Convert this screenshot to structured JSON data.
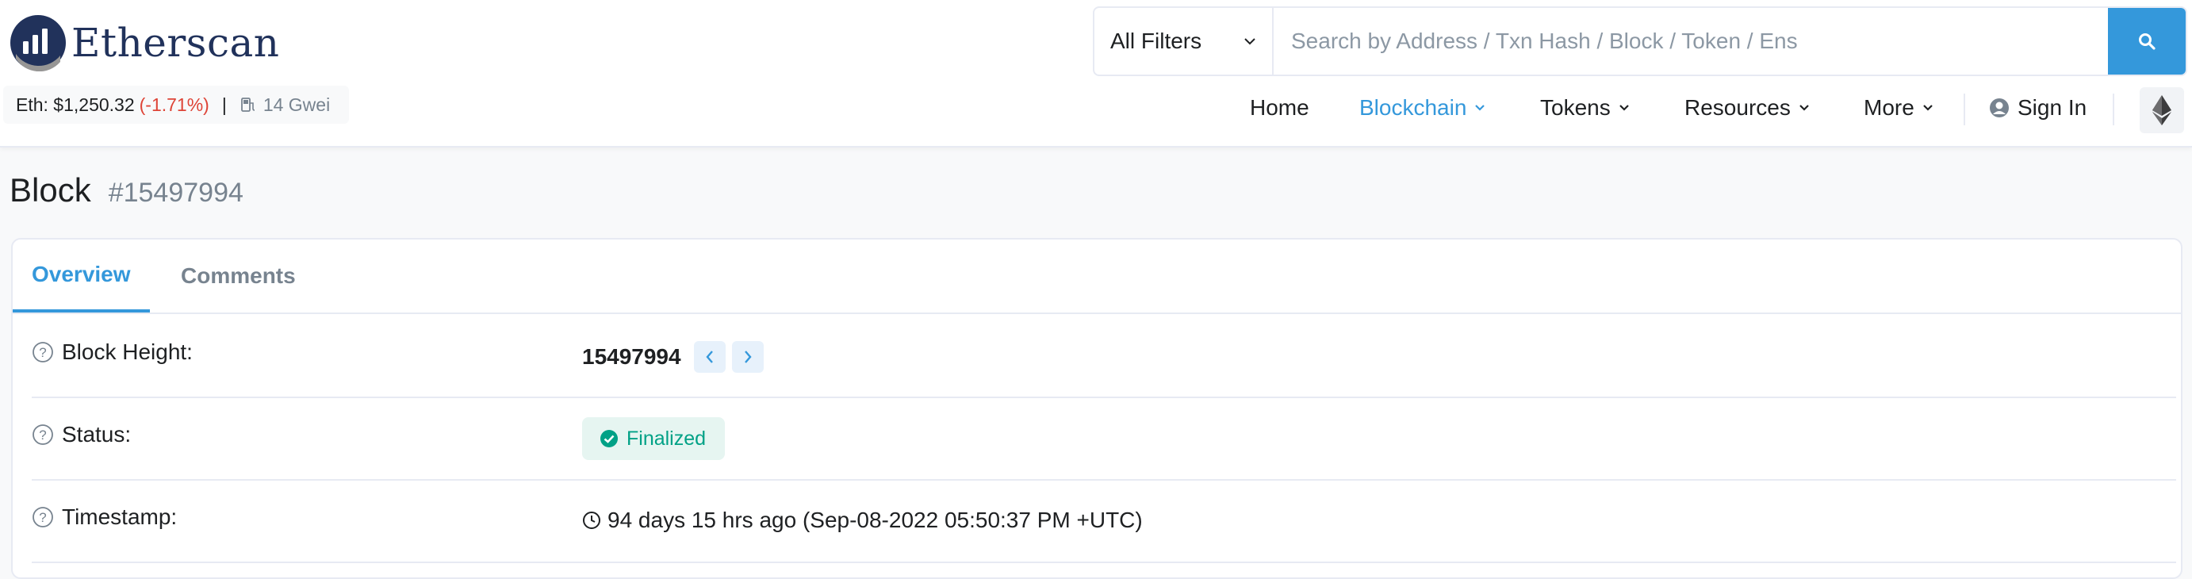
{
  "header": {
    "brand": "Etherscan",
    "price": {
      "eth_label": "Eth: $1,250.32",
      "change": "(-1.71%)",
      "separator": "|",
      "gas": "14 Gwei"
    },
    "search": {
      "filter_label": "All Filters",
      "placeholder": "Search by Address / Txn Hash / Block / Token / Ens"
    },
    "nav": {
      "home": "Home",
      "blockchain": "Blockchain",
      "tokens": "Tokens",
      "resources": "Resources",
      "more": "More",
      "sign_in": "Sign In"
    }
  },
  "page": {
    "title": "Block",
    "block_ref": "#15497994"
  },
  "tabs": {
    "overview": "Overview",
    "comments": "Comments"
  },
  "details": {
    "block_height": {
      "label": "Block Height:",
      "value": "15497994"
    },
    "status": {
      "label": "Status:",
      "value": "Finalized"
    },
    "timestamp": {
      "label": "Timestamp:",
      "value": "94 days 15 hrs ago (Sep-08-2022 05:50:37 PM +UTC)"
    }
  },
  "colors": {
    "accent": "#3498db",
    "negative": "#de4437",
    "success": "#00a186",
    "brand_navy": "#21325b"
  },
  "icons": [
    "etherscan-logo-icon",
    "gas-pump-icon",
    "chevron-down-icon",
    "search-icon",
    "user-circle-icon",
    "ethereum-icon",
    "help-circle-icon",
    "chevron-left-icon",
    "chevron-right-icon",
    "check-circle-icon",
    "clock-icon"
  ]
}
